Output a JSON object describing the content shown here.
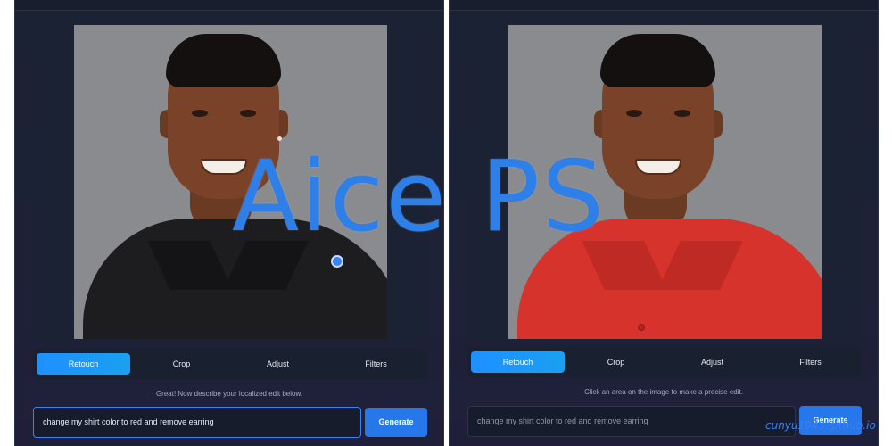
{
  "overlay_title": "Aice PS",
  "watermark": "cunyu1943.github.io",
  "colors": {
    "accent": "#2577ea",
    "tab_active": "#1e90ff",
    "overlay": "#2f7fe8"
  },
  "left_panel": {
    "tabs": [
      "Retouch",
      "Crop",
      "Adjust",
      "Filters"
    ],
    "active_tab": "Retouch",
    "hint": "Great! Now describe your localized edit below.",
    "prompt_value": "change my shirt color to red and remove earring",
    "generate_label": "Generate"
  },
  "right_panel": {
    "tabs": [
      "Retouch",
      "Crop",
      "Adjust",
      "Filters"
    ],
    "active_tab": "Retouch",
    "hint": "Click an area on the image to make a precise edit.",
    "prompt_placeholder": "change my shirt color to red and remove earring",
    "generate_label": "Generate"
  }
}
